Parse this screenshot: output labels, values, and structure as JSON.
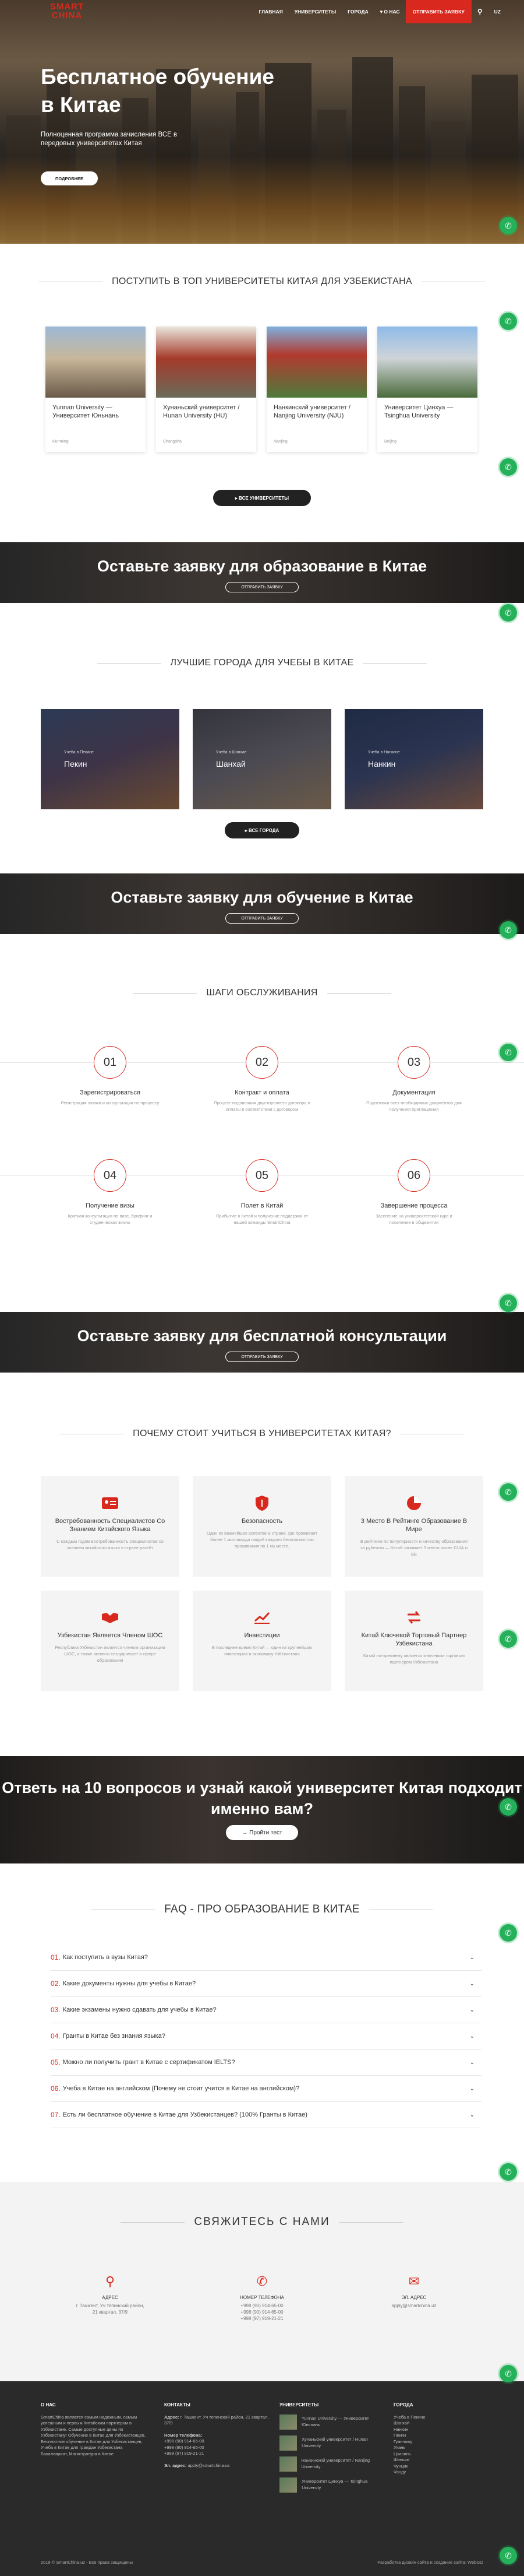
{
  "header": {
    "logo_line1": "SMART",
    "logo_line2": "CHINA",
    "nav": [
      "Главная",
      "Университеты",
      "Города",
      "О нас"
    ],
    "cta": "Отправить заявку",
    "lang": "UZ"
  },
  "hero": {
    "title": "Бесплатное обучение в Китае",
    "subtitle": "Полноценная программа зачисления ВСЕ в передовых университетах Китая",
    "button": "Подробнее"
  },
  "universities": {
    "heading": "Поступить в топ университеты Китая для Узбекистана",
    "items": [
      {
        "name": "Yunnan University — Университет Юньнань",
        "tag": "Kunming"
      },
      {
        "name": "Хунаньский университет / Hunan University (HU)",
        "tag": "Changsha"
      },
      {
        "name": "Нанкинский университет / Nanjing University (NJU)",
        "tag": "Nanjing"
      },
      {
        "name": "Университет Цинхуа — Tsinghua University",
        "tag": "Beijing"
      }
    ],
    "button": "Все университеты"
  },
  "banner1": {
    "title": "Оставьте заявку для образование в Китае",
    "button": "Отправить заявку"
  },
  "cities": {
    "heading": "Лучшие города для учебы в Китае",
    "items": [
      {
        "name": "Пекин",
        "label": "Учеба в Пекине"
      },
      {
        "name": "Шанхай",
        "label": "Учеба в Шанхае"
      },
      {
        "name": "Нанкин",
        "label": "Учеба в Нанкине"
      }
    ],
    "button": "Все города"
  },
  "banner2": {
    "title": "Оставьте заявку для обучение в Китае",
    "button": "Отправить заявку"
  },
  "steps": {
    "heading": "Шаги обслуживания",
    "items": [
      {
        "num": "01",
        "title": "Зарегистрироваться",
        "desc": "Регистрация заявки и консультация по процессу"
      },
      {
        "num": "02",
        "title": "Контракт и оплата",
        "desc": "Процесс подписания двустороннего договора и оплаты в соответствии с договором"
      },
      {
        "num": "03",
        "title": "Документация",
        "desc": "Подготовка всех необходимых документов для получения приглашения"
      },
      {
        "num": "04",
        "title": "Получение визы",
        "desc": "Краткая консультация по визе, брифинг и студенческая жизнь"
      },
      {
        "num": "05",
        "title": "Полет в Китай",
        "desc": "Прибытие в Китай и получение поддержки от нашей команды SmartChina"
      },
      {
        "num": "06",
        "title": "Завершение процесса",
        "desc": "Заселение на университетский курс и поселение в общежитии"
      }
    ]
  },
  "banner3": {
    "title": "Оставьте заявку для бесплатной консультации",
    "button": "Отправить заявку"
  },
  "why": {
    "heading": "Почему стоит учиться в университетах Китая?",
    "items": [
      {
        "title": "Востребованность Специалистов Со Знанием Китайского Языка",
        "desc": "С каждым годом востребованность специалистов со знанием китайского языка в стране растёт",
        "icon": "id-card-icon"
      },
      {
        "title": "Безопасность",
        "desc": "Один из важнейших аспектов В стране, где проживает более 1 миллиарда людей каждого безопасностью проживания по 1 на месте.",
        "icon": "shield-icon"
      },
      {
        "title": "3 Место В Рейтинге Образование В Мире",
        "desc": "В рейтинге по популярности и качеству образования за рубежом — Китай занимает 3 место после США и ВБ",
        "icon": "pie-chart-icon"
      },
      {
        "title": "Узбекистан Является Членом ШОС",
        "desc": "Республика Узбекистан является членом организации ШОС, а также активно сотрудничает в сфере образования",
        "icon": "handshake-icon"
      },
      {
        "title": "Инвестиции",
        "desc": "В последнее время Китай — один из крупнейших инвесторов в экономику Узбекистана",
        "icon": "chart-icon"
      },
      {
        "title": "Китай Ключевой Торговый Партнер Узбекистана",
        "desc": "Китай по-прежнему является ключевым торговым партнером Узбекистана",
        "icon": "exchange-icon"
      }
    ]
  },
  "quiz": {
    "title": "Ответь на 10 вопросов и узнай какой университет Китая подходит именно вам?",
    "button": "Пройти тест"
  },
  "faq": {
    "heading": "FAQ - Про образование в Китае",
    "items": [
      {
        "num": "01.",
        "q": "Как поступить в вузы Китая?"
      },
      {
        "num": "02.",
        "q": "Какие документы нужны для учебы в Китае?"
      },
      {
        "num": "03.",
        "q": "Какие экзамены нужно сдавать для учебы в Китае?"
      },
      {
        "num": "04.",
        "q": "Гранты в Китае без знания языка?"
      },
      {
        "num": "05.",
        "q": "Можно ли получить грант в Китае с сертификатом IELTS?"
      },
      {
        "num": "06.",
        "q": "Учеба в Китае на английском (Почему не стоит учится в Китае на английском)?"
      },
      {
        "num": "07.",
        "q": "Есть ли бесплатное обучение в Китае для Узбекистанцев? (100% Гранты в Китае)"
      }
    ]
  },
  "contacts": {
    "heading": "Свяжитесь с нами",
    "items": [
      {
        "title": "Адрес",
        "lines": [
          "г. Ташкент, Уч тепинский район,",
          "21 квартал, 37/9"
        ]
      },
      {
        "title": "Номер телефона",
        "lines": [
          "+998 (90) 914-65-00",
          "+998 (90) 914-65-00",
          "+998 (97) 919-21-21"
        ]
      },
      {
        "title": "Эл. адрес",
        "lines": [
          "apply@smartchina.uz"
        ]
      }
    ]
  },
  "footer": {
    "about_h": "О нас",
    "about": "SmartChina является самым надежным, самым успешным и первым Китайским партнером в Узбекистане. Самые доступные цены по Узбекистану! Обучение в Китае для Узбекистанцев, Бесплатное обучение в Китае для Узбекистанцев, Учеба в Китае для граждан Узбекистана Бакалавриат, Магистратура в Китае",
    "contacts_h": "Контакты",
    "address_label": "Адрес:",
    "address": "г. Ташкент, Уч тепинский район, 21 квартал, 37/9",
    "phone_label": "Номер телефона:",
    "phones": [
      "+998 (90) 914-65-00",
      "+998 (90) 914-65-00",
      "+998 (97) 919-21-21"
    ],
    "email_label": "Эл. адрес:",
    "email": "apply@smartchina.uz",
    "unis_h": "Университеты",
    "unis": [
      "Yunnan University — Университет Юньнань",
      "Хунаньский университет / Hunan University",
      "Нанкинский университет / Nanjing University",
      "Университет Цинхуа — Tsinghua University"
    ],
    "cities_h": "Города",
    "cities": [
      "Учеба в Пекине",
      "Шанхай",
      "Нанкин",
      "Пекин",
      "Гуанчжоу",
      "Ухань",
      "Цзилинь",
      "Шэньян",
      "Чунцин",
      "Чэнду"
    ],
    "copyright": "2019 © SmartChina.uz - Все права защищены",
    "dev": "Разработка дизайн сайта и создание сайта: WebGO"
  }
}
